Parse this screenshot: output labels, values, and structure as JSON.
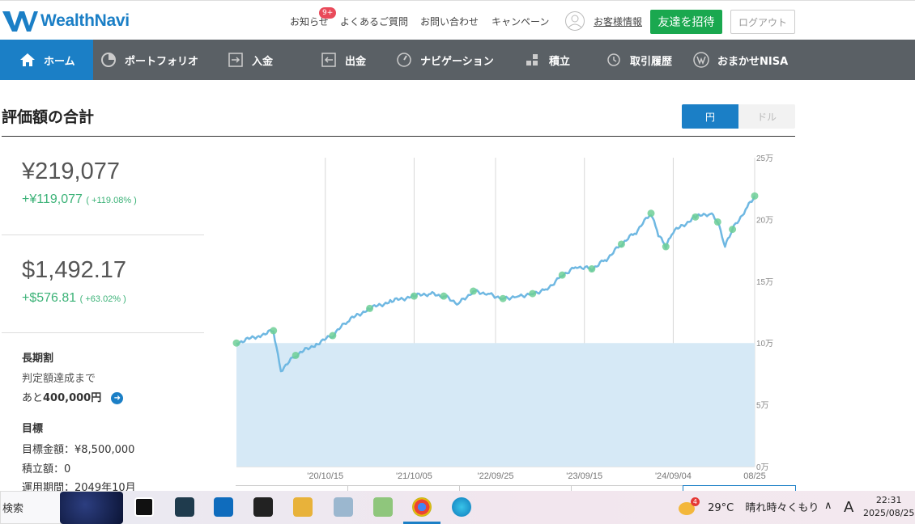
{
  "header": {
    "brand": "WealthNavi",
    "links": [
      "お知らせ",
      "よくあるご質問",
      "お問い合わせ",
      "キャンペーン"
    ],
    "notification_badge": "9+",
    "account_link": "お客様情報",
    "invite_button": "友達を招待",
    "logout_button": "ログアウト",
    "brand_color": "#1b7fc6"
  },
  "nav": {
    "items": [
      {
        "label": "ホーム",
        "icon": "home-icon",
        "active": true
      },
      {
        "label": "ポートフォリオ",
        "icon": "pie-chart-icon",
        "active": false
      },
      {
        "label": "入金",
        "icon": "deposit-icon",
        "active": false
      },
      {
        "label": "出金",
        "icon": "withdraw-icon",
        "active": false
      },
      {
        "label": "ナビゲーション",
        "icon": "navigation-icon",
        "active": false
      },
      {
        "label": "積立",
        "icon": "blocks-icon",
        "active": false
      },
      {
        "label": "取引履歴",
        "icon": "history-icon",
        "active": false
      },
      {
        "label": "おまかせNISA",
        "icon": "nisa-icon",
        "active": false
      }
    ]
  },
  "summary": {
    "title": "評価額の合計",
    "currency_toggle": {
      "yen": "円",
      "dollar": "ドル",
      "selected": "円"
    },
    "yen_total": "¥219,077",
    "yen_gain": "+¥119,077",
    "yen_gain_pct": "( +119.08% )",
    "usd_total": "$1,492.17",
    "usd_gain": "+$576.81",
    "usd_gain_pct": "( +63.02% )"
  },
  "plan": {
    "long_term_label": "長期割",
    "long_term_desc": "判定額達成まで",
    "long_term_remaining_prefix": "あと",
    "long_term_remaining": "400,000円",
    "goal_label": "目標",
    "goal_amount": "目標金額：¥8,500,000",
    "monthly_amount": "積立額：0",
    "period": "運用期間：2049年10月"
  },
  "chart_data": {
    "type": "line",
    "x_tick_labels": [
      "'20/10/15",
      "'21/10/05",
      "'22/09/25",
      "'23/09/15",
      "'24/09/04",
      "08/25"
    ],
    "y_tick_labels": [
      "0万",
      "5万",
      "10万",
      "15万",
      "20万",
      "25万"
    ],
    "ylim": [
      0,
      250000
    ],
    "series": [
      {
        "color": "#6fb8e2",
        "x": [
          "2019-10",
          "2020-01",
          "2020-03",
          "2020-04",
          "2020-06",
          "2020-09",
          "2020-11",
          "2021-01",
          "2021-04",
          "2021-07",
          "2021-10",
          "2021-12",
          "2022-02",
          "2022-04",
          "2022-06",
          "2022-08",
          "2022-10",
          "2022-12",
          "2023-02",
          "2023-04",
          "2023-06",
          "2023-08",
          "2023-10",
          "2023-12",
          "2024-02",
          "2024-04",
          "2024-06",
          "2024-07",
          "2024-08",
          "2024-09",
          "2024-12",
          "2025-02",
          "2025-03",
          "2025-04",
          "2025-05",
          "2025-07",
          "2025-08"
        ],
        "values": [
          100000,
          106000,
          110000,
          78000,
          90000,
          100000,
          106000,
          118000,
          128000,
          134000,
          138000,
          140000,
          138000,
          132000,
          142000,
          140000,
          136000,
          138000,
          140000,
          144000,
          155000,
          162000,
          160000,
          168000,
          180000,
          190000,
          205000,
          188000,
          178000,
          190000,
          202000,
          205000,
          198000,
          178000,
          192000,
          210000,
          219000
        ]
      },
      {
        "color": "#d6e9f6",
        "x": [
          "2019-10",
          "2025-08"
        ],
        "values": [
          100000,
          100000
        ]
      }
    ]
  },
  "taskbar": {
    "search": "検索",
    "weather_temp": "29°C",
    "weather_desc": "晴れ時々くもり",
    "weather_badge": "4",
    "ime": "A",
    "time": "22:31",
    "date": "2025/08/25"
  }
}
